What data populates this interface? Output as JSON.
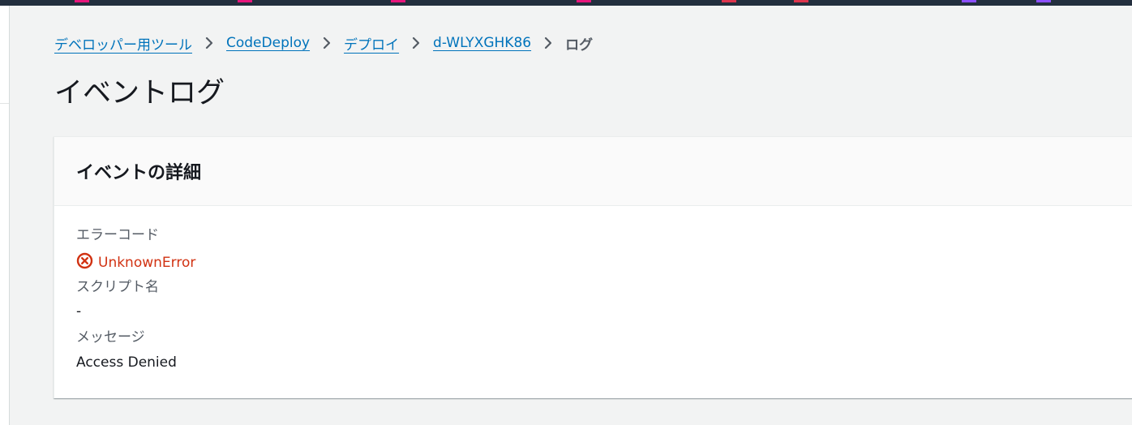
{
  "colors": {
    "top_bar": "#232f3e",
    "link": "#0073bb",
    "error": "#d13212",
    "background": "#f2f3f3"
  },
  "top_bar_service_icons": [
    {
      "name": "service-icon",
      "color": "#e7157b"
    },
    {
      "name": "service-icon",
      "color": "#e7157b"
    },
    {
      "name": "service-icon",
      "color": "#e7157b"
    },
    {
      "name": "service-icon",
      "color": "#e7157b"
    },
    {
      "name": "service-icon",
      "color": "#dd344c"
    },
    {
      "name": "service-icon",
      "color": "#dd344c"
    },
    {
      "name": "service-icon",
      "color": "#8c4fff"
    },
    {
      "name": "service-icon",
      "color": "#8c4fff"
    }
  ],
  "breadcrumb": {
    "items": [
      {
        "label": "デベロッパー用ツール"
      },
      {
        "label": "CodeDeploy"
      },
      {
        "label": "デプロイ"
      },
      {
        "label": "d-WLYXGHK86"
      }
    ],
    "current": "ログ",
    "separator_icon": "chevron-right-icon"
  },
  "page_title": "イベントログ",
  "panel": {
    "title": "イベントの詳細",
    "fields": {
      "error_code": {
        "label": "エラーコード",
        "value": "UnknownError",
        "icon": "error-circle-icon"
      },
      "script_name": {
        "label": "スクリプト名",
        "value": "-"
      },
      "message": {
        "label": "メッセージ",
        "value": "Access Denied"
      }
    }
  }
}
